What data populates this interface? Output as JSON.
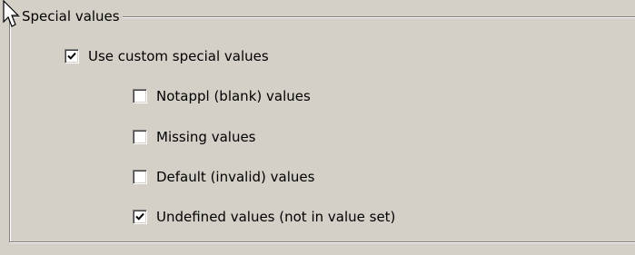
{
  "group": {
    "legend": "Special values"
  },
  "options": [
    {
      "id": "custom",
      "label": "Use custom special values",
      "checked": true
    },
    {
      "id": "notappl",
      "label": "Notappl (blank) values",
      "checked": false
    },
    {
      "id": "missing",
      "label": "Missing values",
      "checked": false
    },
    {
      "id": "default",
      "label": "Default (invalid) values",
      "checked": false
    },
    {
      "id": "undefined",
      "label": "Undefined values (not in value set)",
      "checked": true
    }
  ],
  "icons": {
    "cursor": "mouse-pointer-icon",
    "check": "checkmark-icon"
  },
  "colors": {
    "panel_background": "#d4d0c8",
    "shadow": "#808080",
    "highlight": "#ffffff",
    "text": "#000000"
  }
}
